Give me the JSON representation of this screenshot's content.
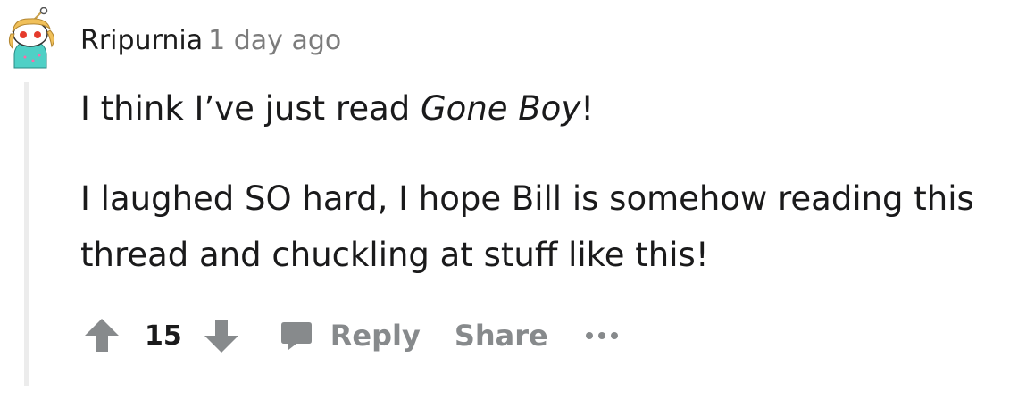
{
  "comment": {
    "username": "Rripurnia",
    "timestamp": "1 day ago",
    "body": {
      "p1_before": "I think I’ve just read ",
      "p1_italic": "Gone Boy",
      "p1_after": "!",
      "p2": "I laughed SO hard, I hope Bill is somehow reading this thread and chuckling at stuff like this!"
    }
  },
  "actions": {
    "upvote_icon": "arrow-up-icon",
    "vote_count": "15",
    "downvote_icon": "arrow-down-icon",
    "reply_icon": "speech-bubble-icon",
    "reply_label": "Reply",
    "share_label": "Share",
    "more_icon": "ellipsis-icon"
  },
  "colors": {
    "username": "#1c1c1c",
    "timestamp": "#7c7c7c",
    "body_text": "#1a1a1b",
    "action_gray": "#878a8c",
    "thread_line": "#ececec"
  }
}
